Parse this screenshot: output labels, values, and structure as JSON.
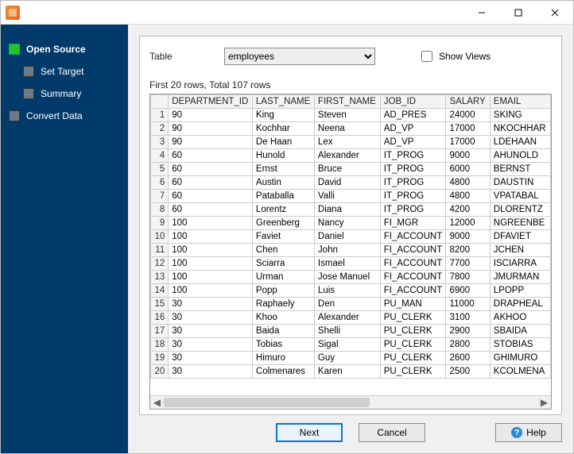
{
  "window": {
    "minimize_icon": "minimize-icon",
    "maximize_icon": "maximize-icon",
    "close_icon": "close-icon"
  },
  "sidebar": {
    "items": [
      {
        "label": "Open Source",
        "active": true
      },
      {
        "label": "Set Target",
        "active": false
      },
      {
        "label": "Summary",
        "active": false
      },
      {
        "label": "Convert Data",
        "active": false
      }
    ]
  },
  "tablearea": {
    "table_label": "Table",
    "table_value": "employees",
    "show_views_label": "Show Views",
    "show_views_checked": false,
    "status": "First 20 rows, Total 107 rows",
    "columns": [
      "DEPARTMENT_ID",
      "LAST_NAME",
      "FIRST_NAME",
      "JOB_ID",
      "SALARY",
      "EMAIL"
    ],
    "rows": [
      {
        "DEPARTMENT_ID": "90",
        "LAST_NAME": "King",
        "FIRST_NAME": "Steven",
        "JOB_ID": "AD_PRES",
        "SALARY": "24000",
        "EMAIL": "SKING"
      },
      {
        "DEPARTMENT_ID": "90",
        "LAST_NAME": "Kochhar",
        "FIRST_NAME": "Neena",
        "JOB_ID": "AD_VP",
        "SALARY": "17000",
        "EMAIL": "NKOCHHAR"
      },
      {
        "DEPARTMENT_ID": "90",
        "LAST_NAME": "De Haan",
        "FIRST_NAME": "Lex",
        "JOB_ID": "AD_VP",
        "SALARY": "17000",
        "EMAIL": "LDEHAAN"
      },
      {
        "DEPARTMENT_ID": "60",
        "LAST_NAME": "Hunold",
        "FIRST_NAME": "Alexander",
        "JOB_ID": "IT_PROG",
        "SALARY": "9000",
        "EMAIL": "AHUNOLD"
      },
      {
        "DEPARTMENT_ID": "60",
        "LAST_NAME": "Ernst",
        "FIRST_NAME": "Bruce",
        "JOB_ID": "IT_PROG",
        "SALARY": "6000",
        "EMAIL": "BERNST"
      },
      {
        "DEPARTMENT_ID": "60",
        "LAST_NAME": "Austin",
        "FIRST_NAME": "David",
        "JOB_ID": "IT_PROG",
        "SALARY": "4800",
        "EMAIL": "DAUSTIN"
      },
      {
        "DEPARTMENT_ID": "60",
        "LAST_NAME": "Pataballa",
        "FIRST_NAME": "Valli",
        "JOB_ID": "IT_PROG",
        "SALARY": "4800",
        "EMAIL": "VPATABAL"
      },
      {
        "DEPARTMENT_ID": "60",
        "LAST_NAME": "Lorentz",
        "FIRST_NAME": "Diana",
        "JOB_ID": "IT_PROG",
        "SALARY": "4200",
        "EMAIL": "DLORENTZ"
      },
      {
        "DEPARTMENT_ID": "100",
        "LAST_NAME": "Greenberg",
        "FIRST_NAME": "Nancy",
        "JOB_ID": "FI_MGR",
        "SALARY": "12000",
        "EMAIL": "NGREENBE"
      },
      {
        "DEPARTMENT_ID": "100",
        "LAST_NAME": "Faviet",
        "FIRST_NAME": "Daniel",
        "JOB_ID": "FI_ACCOUNT",
        "SALARY": "9000",
        "EMAIL": "DFAVIET"
      },
      {
        "DEPARTMENT_ID": "100",
        "LAST_NAME": "Chen",
        "FIRST_NAME": "John",
        "JOB_ID": "FI_ACCOUNT",
        "SALARY": "8200",
        "EMAIL": "JCHEN"
      },
      {
        "DEPARTMENT_ID": "100",
        "LAST_NAME": "Sciarra",
        "FIRST_NAME": "Ismael",
        "JOB_ID": "FI_ACCOUNT",
        "SALARY": "7700",
        "EMAIL": "ISCIARRA"
      },
      {
        "DEPARTMENT_ID": "100",
        "LAST_NAME": "Urman",
        "FIRST_NAME": "Jose Manuel",
        "JOB_ID": "FI_ACCOUNT",
        "SALARY": "7800",
        "EMAIL": "JMURMAN"
      },
      {
        "DEPARTMENT_ID": "100",
        "LAST_NAME": "Popp",
        "FIRST_NAME": "Luis",
        "JOB_ID": "FI_ACCOUNT",
        "SALARY": "6900",
        "EMAIL": "LPOPP"
      },
      {
        "DEPARTMENT_ID": "30",
        "LAST_NAME": "Raphaely",
        "FIRST_NAME": "Den",
        "JOB_ID": "PU_MAN",
        "SALARY": "11000",
        "EMAIL": "DRAPHEAL"
      },
      {
        "DEPARTMENT_ID": "30",
        "LAST_NAME": "Khoo",
        "FIRST_NAME": "Alexander",
        "JOB_ID": "PU_CLERK",
        "SALARY": "3100",
        "EMAIL": "AKHOO"
      },
      {
        "DEPARTMENT_ID": "30",
        "LAST_NAME": "Baida",
        "FIRST_NAME": "Shelli",
        "JOB_ID": "PU_CLERK",
        "SALARY": "2900",
        "EMAIL": "SBAIDA"
      },
      {
        "DEPARTMENT_ID": "30",
        "LAST_NAME": "Tobias",
        "FIRST_NAME": "Sigal",
        "JOB_ID": "PU_CLERK",
        "SALARY": "2800",
        "EMAIL": "STOBIAS"
      },
      {
        "DEPARTMENT_ID": "30",
        "LAST_NAME": "Himuro",
        "FIRST_NAME": "Guy",
        "JOB_ID": "PU_CLERK",
        "SALARY": "2600",
        "EMAIL": "GHIMURO"
      },
      {
        "DEPARTMENT_ID": "30",
        "LAST_NAME": "Colmenares",
        "FIRST_NAME": "Karen",
        "JOB_ID": "PU_CLERK",
        "SALARY": "2500",
        "EMAIL": "KCOLMENA"
      }
    ]
  },
  "buttons": {
    "next": "Next",
    "cancel": "Cancel",
    "help": "Help"
  }
}
